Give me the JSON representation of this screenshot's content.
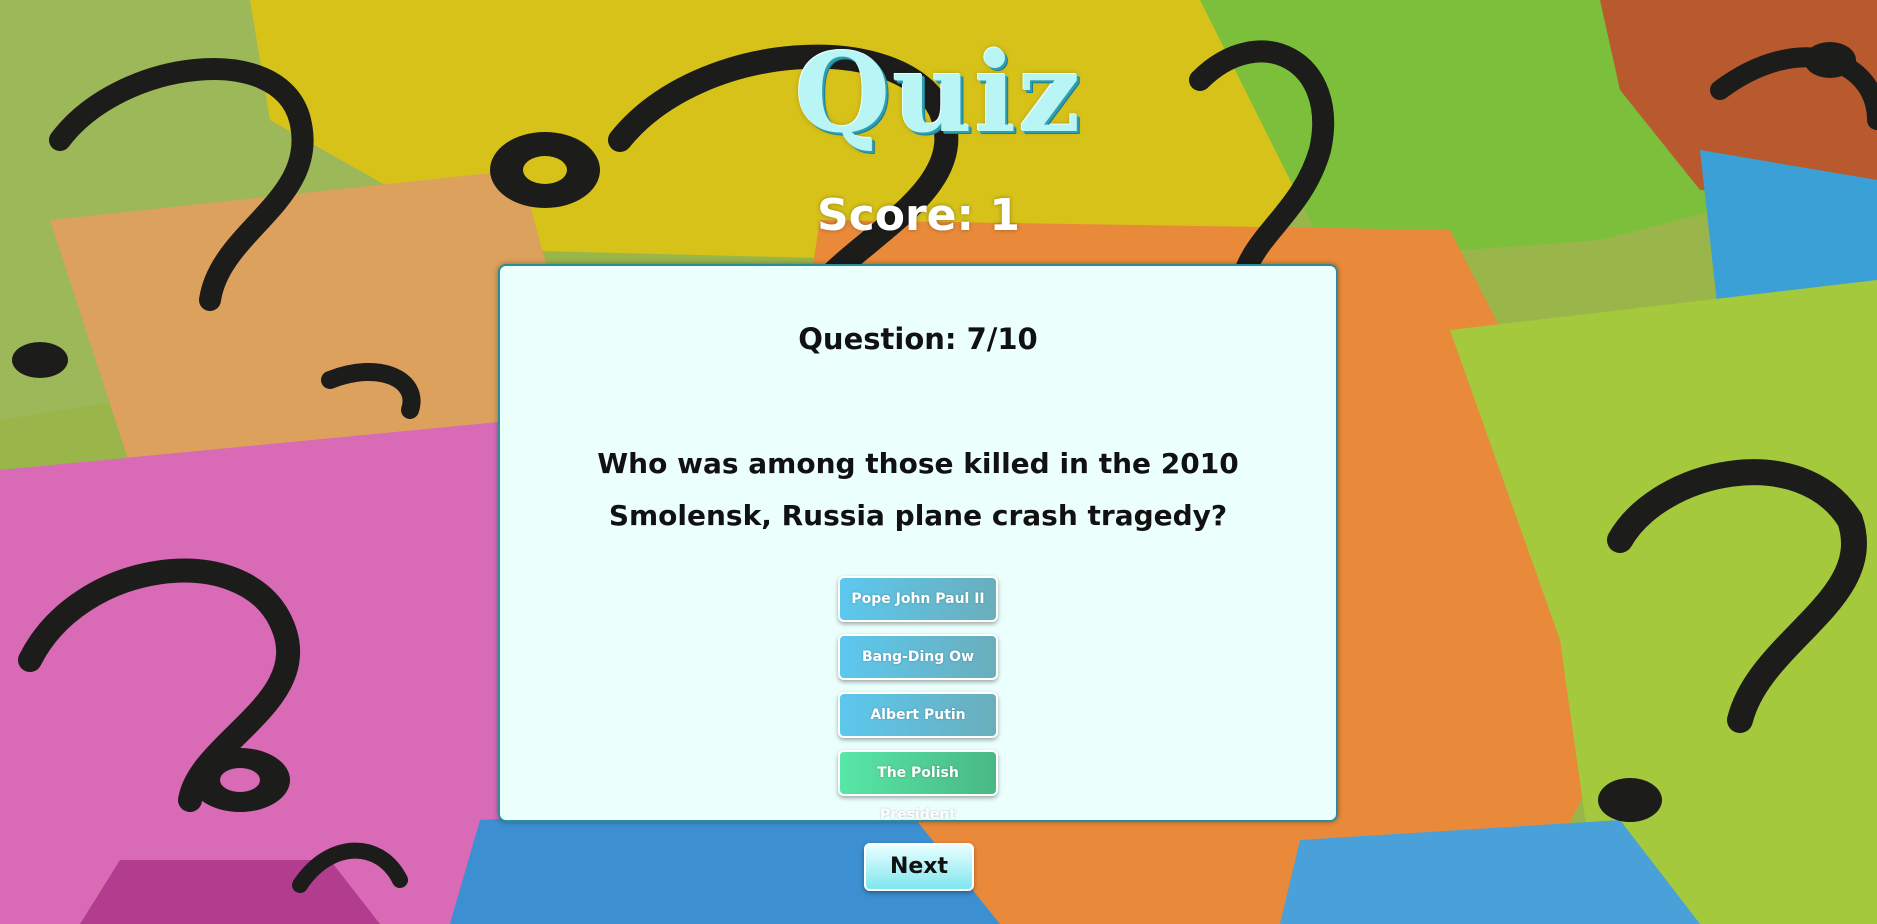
{
  "app": {
    "logo_text": "Quiz"
  },
  "score": {
    "label": "Score: 1"
  },
  "question": {
    "counter": "Question: 7/10",
    "text": "Who was among those killed in the 2010 Smolensk, Russia plane crash tragedy?"
  },
  "answers": [
    {
      "label": "Pope John Paul II",
      "state": "default"
    },
    {
      "label": "Bang-Ding Ow",
      "state": "default"
    },
    {
      "label": "Albert Putin",
      "state": "default"
    },
    {
      "label": "The Polish President",
      "state": "correct"
    }
  ],
  "controls": {
    "next_label": "Next"
  },
  "colors": {
    "card_background": "#ebfffd",
    "card_border": "#2b8c9a",
    "answer_default": "#5cc8ee",
    "answer_correct": "#57e7a6",
    "logo": "#b9f5f5"
  }
}
